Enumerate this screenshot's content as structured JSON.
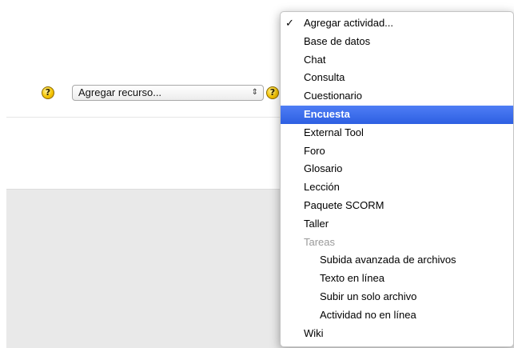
{
  "resource_select": {
    "value": "Agregar recurso...",
    "arrows": "⇕"
  },
  "help_icon_glyph": "?",
  "activity_menu": {
    "checkmark": "✓",
    "items": [
      "Agregar actividad...",
      "Base de datos",
      "Chat",
      "Consulta",
      "Cuestionario",
      "Encuesta",
      "External Tool",
      "Foro",
      "Glosario",
      "Lección",
      "Paquete SCORM",
      "Taller",
      "Tareas",
      "Subida avanzada de archivos",
      "Texto en línea",
      "Subir un solo archivo",
      "Actividad no en línea",
      "Wiki"
    ]
  },
  "colors": {
    "highlight": "#3b6bea",
    "group_label": "#9a9a9a",
    "help_icon": "#f5c400"
  }
}
